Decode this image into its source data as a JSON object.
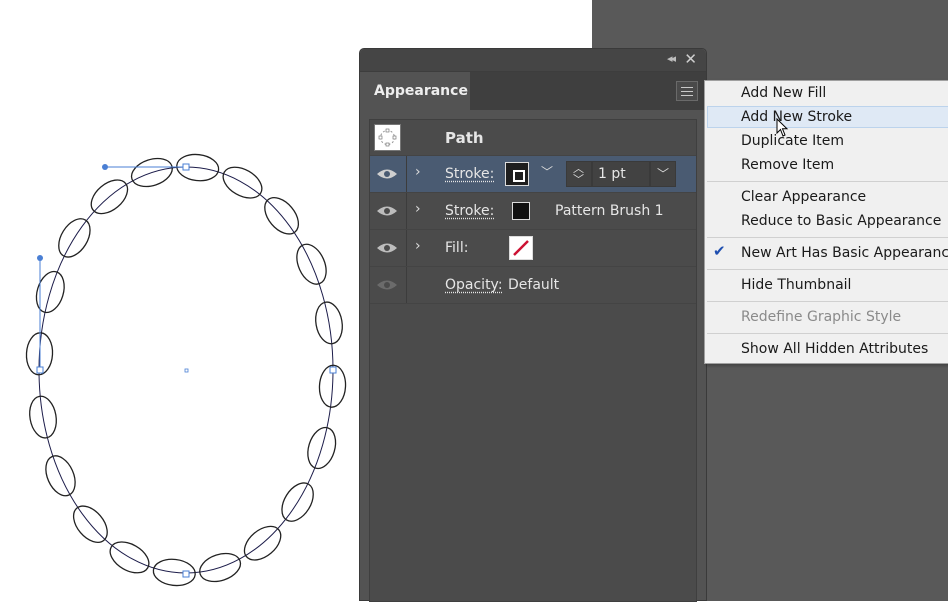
{
  "appearance_panel": {
    "tab_label": "Appearance",
    "object_label": "Path",
    "rows": [
      {
        "label": "Stroke:",
        "weight": "1 pt"
      },
      {
        "label": "Stroke:",
        "brush": "Pattern Brush 1"
      },
      {
        "label": "Fill:"
      },
      {
        "label": "Opacity:",
        "value": "Default"
      }
    ]
  },
  "context_menu": {
    "items": [
      "Add New Fill",
      "Add New Stroke",
      "Duplicate Item",
      "Remove Item",
      "Clear Appearance",
      "Reduce to Basic Appearance",
      "New Art Has Basic Appearance",
      "Hide Thumbnail",
      "Redefine Graphic Style",
      "Show All Hidden Attributes"
    ],
    "highlighted": "Add New Stroke",
    "checked": "New Art Has Basic Appearance",
    "disabled": "Redefine Graphic Style"
  },
  "colors": {
    "selection_blue": "#4a5b72",
    "anchor_blue": "#4a7fd4",
    "fill_none_red": "#cc1133"
  },
  "icons": [
    "collapse-icon",
    "close-icon",
    "panel-menu-icon",
    "visibility-eye-icon",
    "expand-chevron-icon",
    "checkmark-icon",
    "mouse-cursor-icon"
  ]
}
